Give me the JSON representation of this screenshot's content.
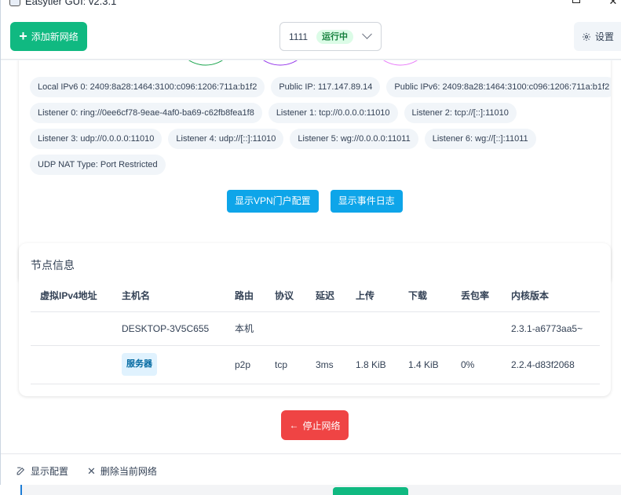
{
  "window": {
    "title": "Easytier GUI: v2.3.1"
  },
  "toolbar": {
    "add_network_label": "添加新网络",
    "network_name": "1111",
    "network_status": "运行中",
    "settings_label": "设置"
  },
  "node_info": {
    "chips_row1": [
      "Local IPv6 0: 2409:8a28:1464:3100:c096:1206:711a:b1f2",
      "Public IP: 117.147.89.14",
      "Public IPv6: 2409:8a28:1464:3100:c096:1206:711a:b1f2"
    ],
    "chips_row2": [
      "Listener 0: ring://0ee6cf78-9eae-4af0-ba69-c62fb8fea1f8",
      "Listener 1: tcp://0.0.0.0:11010",
      "Listener 2: tcp://[::]:11010"
    ],
    "chips_row3": [
      "Listener 3: udp://0.0.0.0:11010",
      "Listener 4: udp://[::]:11010",
      "Listener 5: wg://0.0.0.0:11011",
      "Listener 6: wg://[::]:11011"
    ],
    "chips_row4": [
      "UDP NAT Type: Port Restricted"
    ],
    "show_vpn_portal_label": "显示VPN门户配置",
    "show_event_log_label": "显示事件日志",
    "circle_colors": [
      "#16a34a",
      "#9333ea",
      "#e879f9"
    ]
  },
  "peers": {
    "heading": "节点信息",
    "columns": [
      "虚拟IPv4地址",
      "主机名",
      "路由",
      "协议",
      "延迟",
      "上传",
      "下载",
      "丢包率",
      "内核版本"
    ],
    "rows": [
      {
        "ipv4": "",
        "hostname": "DESKTOP-3V5C655",
        "route": "本机",
        "protocol": "",
        "latency": "",
        "upload": "",
        "download": "",
        "loss": "",
        "version": "2.3.1-a6773aa5~"
      },
      {
        "ipv4": "",
        "hostname": "服务器",
        "route": "p2p",
        "protocol": "tcp",
        "latency": "3ms",
        "upload": "1.8 KiB",
        "download": "1.4 KiB",
        "loss": "0%",
        "version": "2.2.4-d83f2068"
      }
    ]
  },
  "actions": {
    "stop_network_label": "停止网络"
  },
  "footer": {
    "show_config_label": "显示配置",
    "delete_network_label": "删除当前网络"
  },
  "colors": {
    "primary_green": "#10b981",
    "accent_blue": "#0ea5e9",
    "danger_red": "#ef4444"
  }
}
